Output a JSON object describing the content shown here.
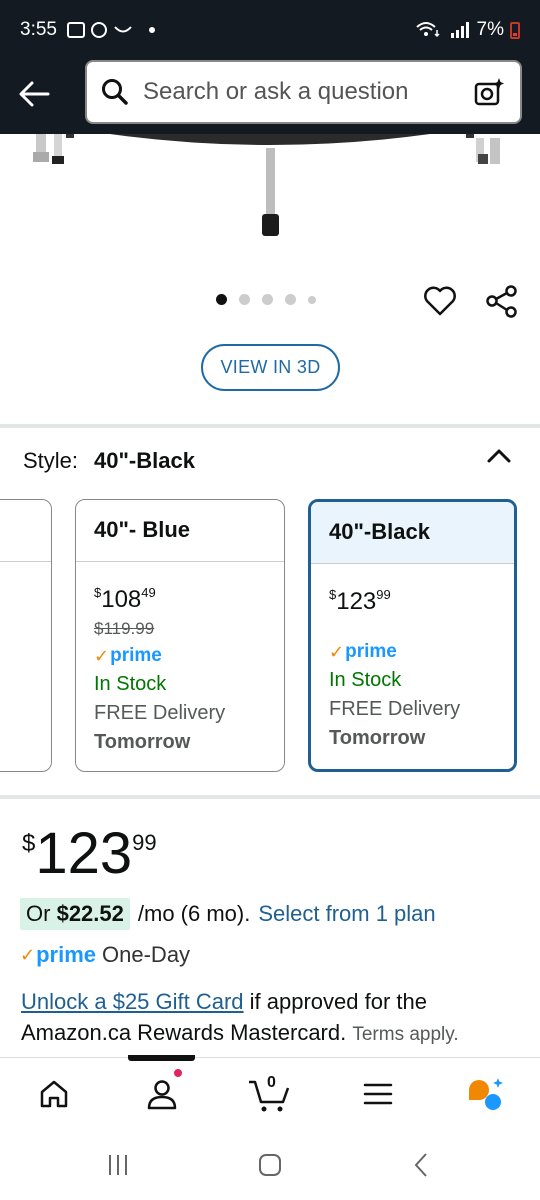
{
  "status_bar": {
    "time": "3:55",
    "battery": "7%"
  },
  "header": {
    "search_placeholder": "Search or ask a question"
  },
  "carousel": {
    "total": 5,
    "active": 1
  },
  "view3d_label": "VIEW IN 3D",
  "style": {
    "label": "Style:",
    "value": "40\"-Black"
  },
  "variants": [
    {
      "name": "40\"- Blue",
      "currency": "$",
      "price_whole": "108",
      "price_fraction": "49",
      "list_price": "$119.99",
      "prime": "prime",
      "stock": "In Stock",
      "delivery": "FREE Delivery",
      "delivery_day": "Tomorrow",
      "selected": false
    },
    {
      "name": "40\"-Black",
      "currency": "$",
      "price_whole": "123",
      "price_fraction": "99",
      "prime": "prime",
      "stock": "In Stock",
      "delivery": "FREE Delivery",
      "delivery_day": "Tomorrow",
      "selected": true
    }
  ],
  "price": {
    "currency": "$",
    "whole": "123",
    "fraction": "99"
  },
  "monthly": {
    "prefix": "Or",
    "amount": "$22.52",
    "term": "/mo (6 mo).",
    "link": "Select from 1 plan"
  },
  "delivery_badge": {
    "prime": "prime",
    "text": "One-Day"
  },
  "promo": {
    "link": "Unlock a $25 Gift Card",
    "text": " if approved for the Amazon.ca Rewards Mastercard.",
    "terms": "Terms apply."
  },
  "bottom_nav": [
    "home",
    "account",
    "cart",
    "menu",
    "rufus"
  ],
  "cart_count": "0",
  "colors": {
    "header_bg": "#131a22",
    "link": "#1f5f92",
    "prime": "#1a98ff",
    "stock": "#007600",
    "accent": "#f08804"
  }
}
